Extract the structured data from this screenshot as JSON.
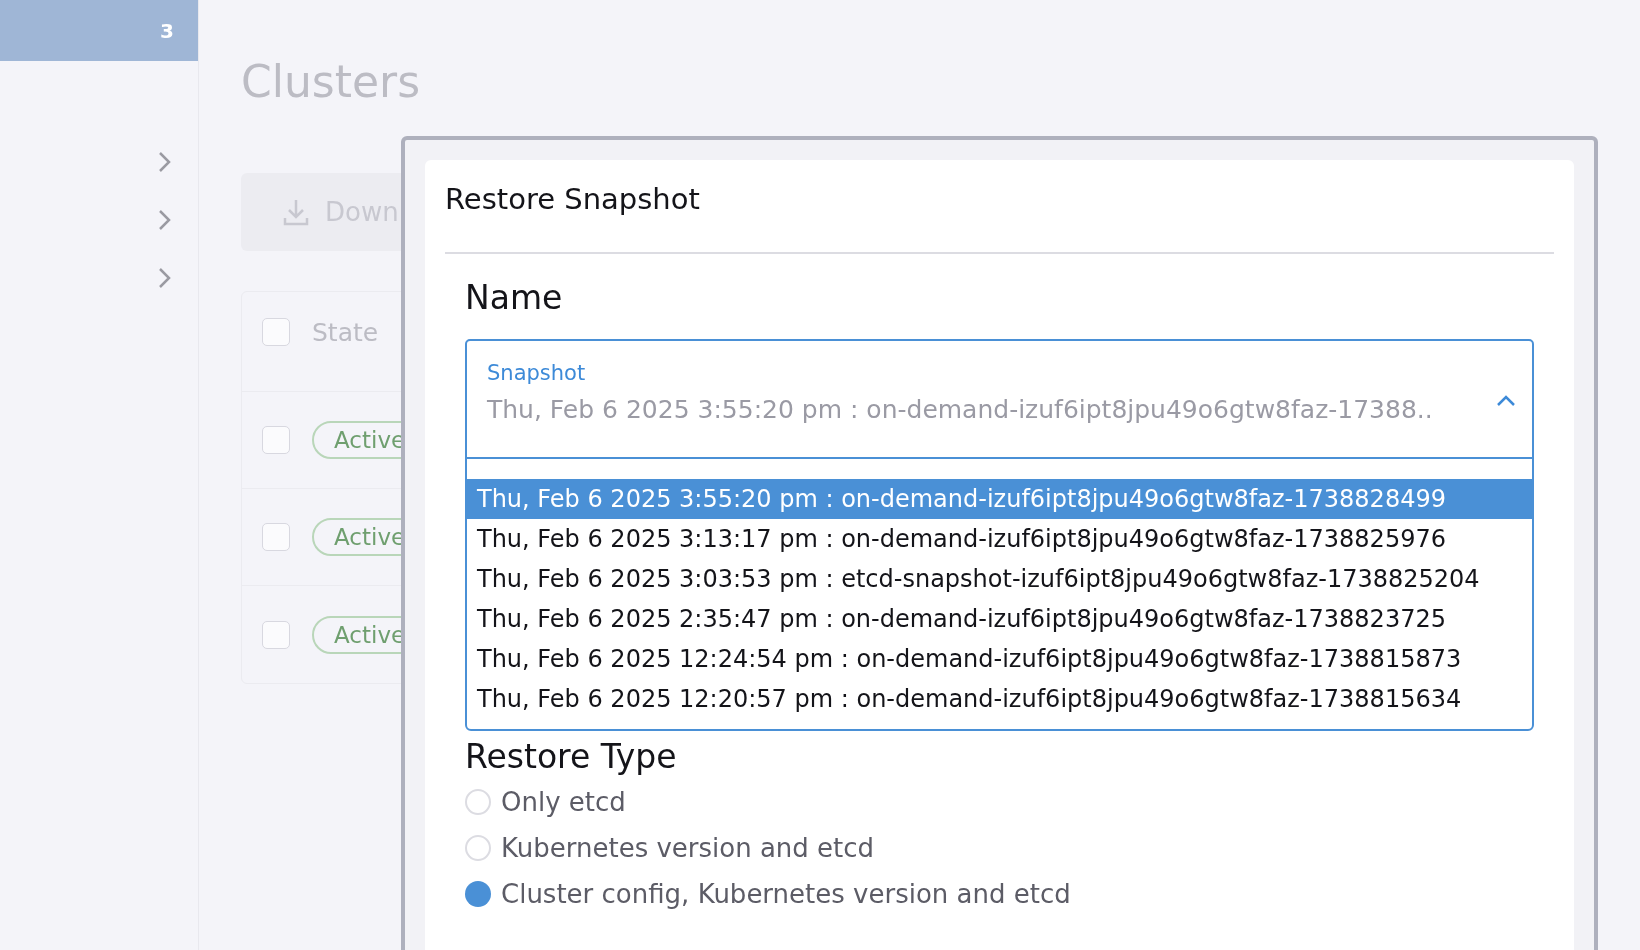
{
  "sidebar": {
    "badge": "3",
    "items": [
      {
        "expanded": false
      },
      {
        "expanded": false
      },
      {
        "expanded": false
      }
    ]
  },
  "page": {
    "title": "Clusters",
    "download_button": "Down",
    "table": {
      "header": "State",
      "all_checked": false,
      "rows": [
        {
          "state": "Active",
          "checked": false
        },
        {
          "state": "Active",
          "checked": false
        },
        {
          "state": "Active",
          "checked": false
        }
      ]
    }
  },
  "dialog": {
    "title": "Restore Snapshot",
    "name_heading": "Name",
    "select": {
      "label": "Snapshot",
      "value": "Thu, Feb 6 2025 3:55:20 pm : on-demand-izuf6ipt8jpu49o6gtw8faz-17388..",
      "expanded": true,
      "options": [
        {
          "label": "Thu, Feb 6 2025 3:55:20 pm : on-demand-izuf6ipt8jpu49o6gtw8faz-1738828499",
          "selected": true
        },
        {
          "label": "Thu, Feb 6 2025 3:13:17 pm : on-demand-izuf6ipt8jpu49o6gtw8faz-1738825976",
          "selected": false
        },
        {
          "label": "Thu, Feb 6 2025 3:03:53 pm : etcd-snapshot-izuf6ipt8jpu49o6gtw8faz-1738825204",
          "selected": false
        },
        {
          "label": "Thu, Feb 6 2025 2:35:47 pm : on-demand-izuf6ipt8jpu49o6gtw8faz-1738823725",
          "selected": false
        },
        {
          "label": "Thu, Feb 6 2025 12:24:54 pm : on-demand-izuf6ipt8jpu49o6gtw8faz-1738815873",
          "selected": false
        },
        {
          "label": "Thu, Feb 6 2025 12:20:57 pm : on-demand-izuf6ipt8jpu49o6gtw8faz-1738815634",
          "selected": false
        }
      ]
    },
    "restore_type": {
      "heading": "Restore Type",
      "options": [
        {
          "label": "Only etcd",
          "selected": false
        },
        {
          "label": "Kubernetes version and etcd",
          "selected": false
        },
        {
          "label": "Cluster config, Kubernetes version and etcd",
          "selected": true
        }
      ]
    }
  }
}
